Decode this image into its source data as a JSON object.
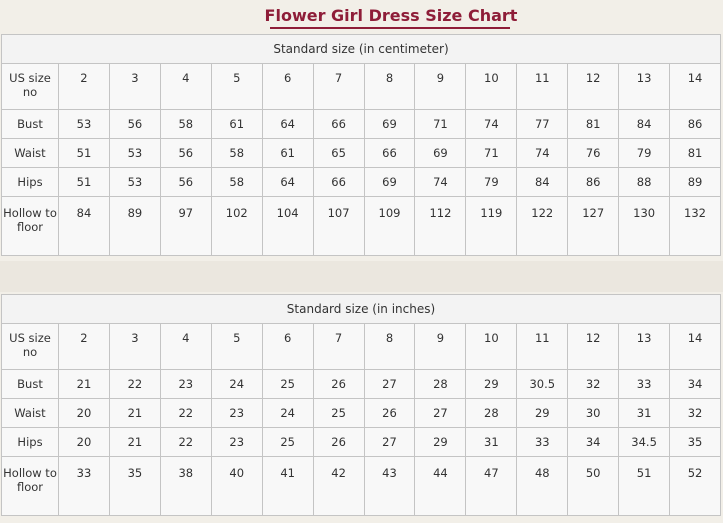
{
  "title": "Flower Girl Dress Size Chart",
  "tables": [
    {
      "caption": "Standard size (in centimeter)",
      "size_header": "US size no",
      "sizes": [
        "2",
        "3",
        "4",
        "5",
        "6",
        "7",
        "8",
        "9",
        "10",
        "11",
        "12",
        "13",
        "14"
      ],
      "rows": [
        {
          "label": "Bust",
          "values": [
            "53",
            "56",
            "58",
            "61",
            "64",
            "66",
            "69",
            "71",
            "74",
            "77",
            "81",
            "84",
            "86"
          ]
        },
        {
          "label": "Waist",
          "values": [
            "51",
            "53",
            "56",
            "58",
            "61",
            "65",
            "66",
            "69",
            "71",
            "74",
            "76",
            "79",
            "81"
          ]
        },
        {
          "label": "Hips",
          "values": [
            "51",
            "53",
            "56",
            "58",
            "64",
            "66",
            "69",
            "74",
            "79",
            "84",
            "86",
            "88",
            "89"
          ]
        },
        {
          "label": "Hollow to floor",
          "values": [
            "84",
            "89",
            "97",
            "102",
            "104",
            "107",
            "109",
            "112",
            "119",
            "122",
            "127",
            "130",
            "132"
          ]
        }
      ]
    },
    {
      "caption": "Standard size (in inches)",
      "size_header": "US size no",
      "sizes": [
        "2",
        "3",
        "4",
        "5",
        "6",
        "7",
        "8",
        "9",
        "10",
        "11",
        "12",
        "13",
        "14"
      ],
      "rows": [
        {
          "label": "Bust",
          "values": [
            "21",
            "22",
            "23",
            "24",
            "25",
            "26",
            "27",
            "28",
            "29",
            "30.5",
            "32",
            "33",
            "34"
          ]
        },
        {
          "label": "Waist",
          "values": [
            "20",
            "21",
            "22",
            "23",
            "24",
            "25",
            "26",
            "27",
            "28",
            "29",
            "30",
            "31",
            "32"
          ]
        },
        {
          "label": "Hips",
          "values": [
            "20",
            "21",
            "22",
            "23",
            "25",
            "26",
            "27",
            "29",
            "31",
            "33",
            "34",
            "34.5",
            "35"
          ]
        },
        {
          "label": "Hollow to floor",
          "values": [
            "33",
            "35",
            "38",
            "40",
            "41",
            "42",
            "43",
            "44",
            "47",
            "48",
            "50",
            "51",
            "52"
          ]
        }
      ]
    }
  ],
  "colors": {
    "title": "#8e1d38",
    "background": "#f2efe8",
    "cell": "#f8f8f8",
    "border": "#c4c4c4"
  }
}
